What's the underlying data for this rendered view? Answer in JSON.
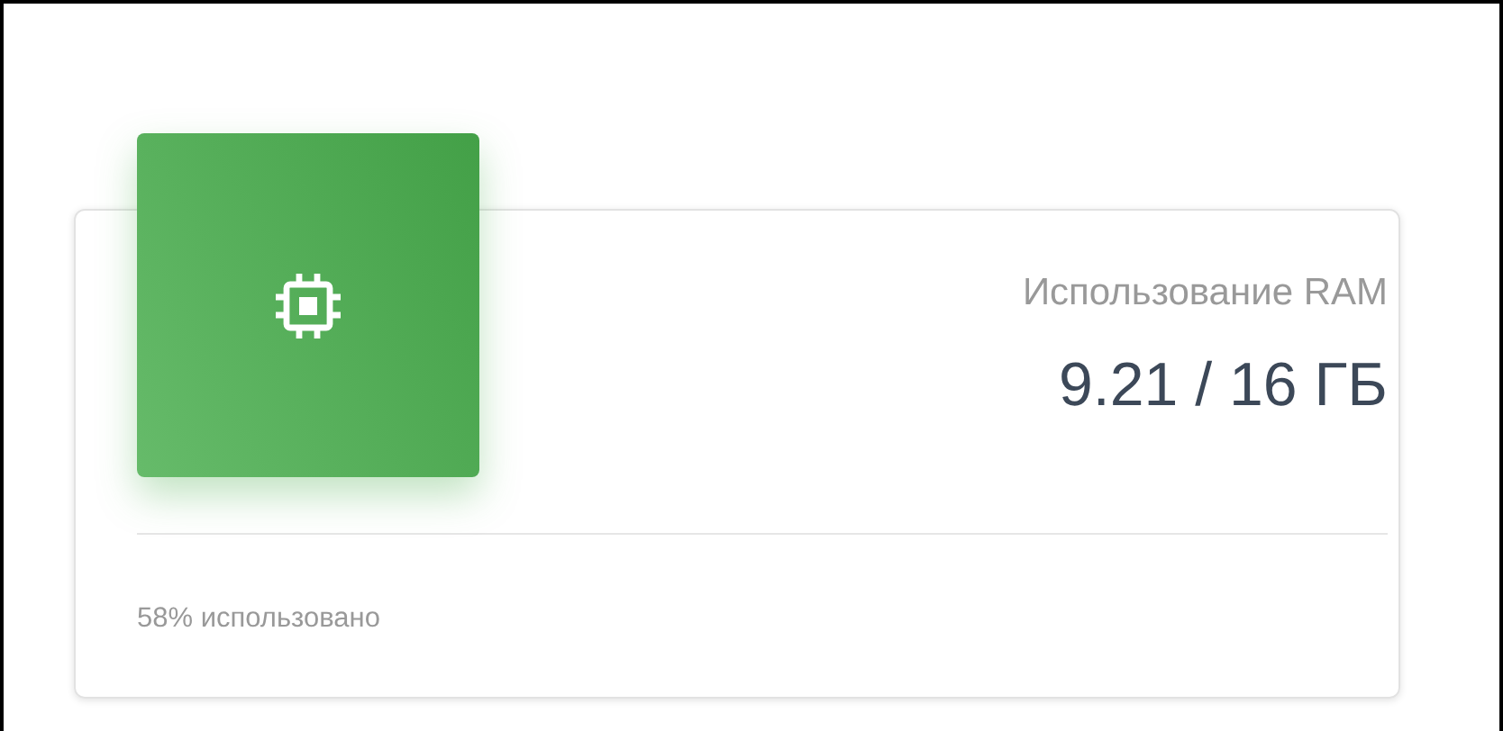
{
  "card": {
    "title": "Использование RAM",
    "value": "9.21 / 16 ГБ",
    "footer": "58% использовано"
  }
}
